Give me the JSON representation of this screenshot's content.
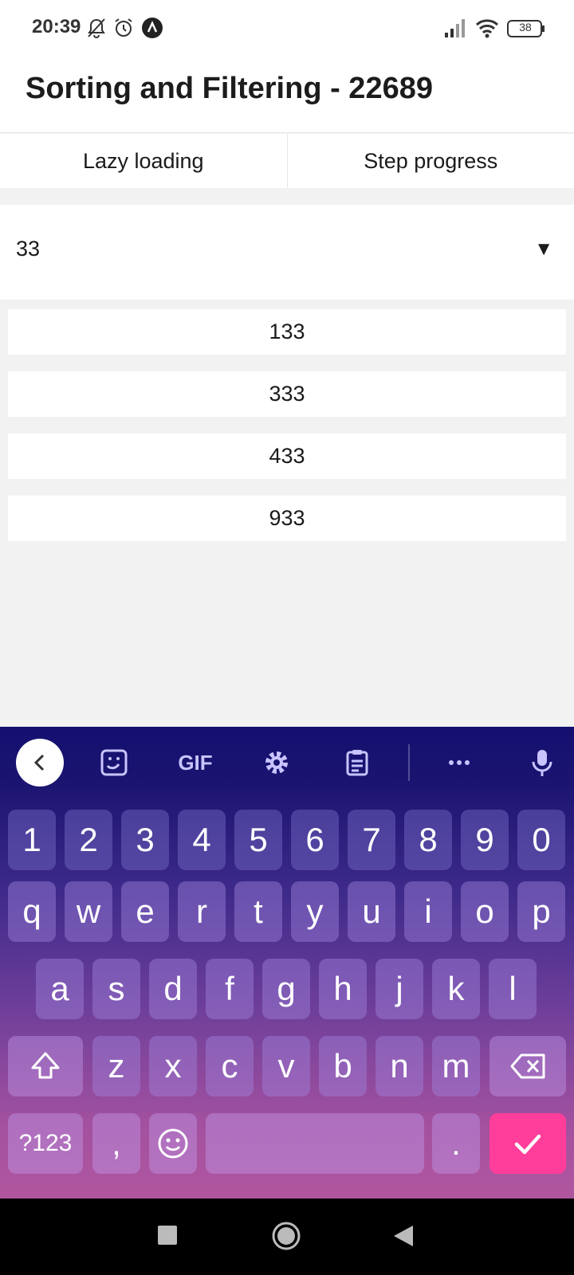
{
  "status_bar": {
    "time": "20:39",
    "battery": "38",
    "icons": [
      "bell-off-icon",
      "alarm-icon",
      "app-notification-icon",
      "signal-icon",
      "wifi-icon",
      "battery-icon"
    ]
  },
  "header": {
    "title": "Sorting and Filtering - 22689"
  },
  "tabs": [
    {
      "label": "Lazy loading"
    },
    {
      "label": "Step progress"
    }
  ],
  "select": {
    "value": "33",
    "arrow": "▼"
  },
  "results": [
    {
      "label": "133"
    },
    {
      "label": "333"
    },
    {
      "label": "433"
    },
    {
      "label": "933"
    }
  ],
  "keyboard": {
    "toolbar": [
      "back-icon",
      "sticker-icon",
      "GIF",
      "settings-icon",
      "clipboard-icon",
      "more-icon",
      "mic-icon"
    ],
    "gif_label": "GIF",
    "row_numbers": [
      "1",
      "2",
      "3",
      "4",
      "5",
      "6",
      "7",
      "8",
      "9",
      "0"
    ],
    "row1": [
      "q",
      "w",
      "e",
      "r",
      "t",
      "y",
      "u",
      "i",
      "o",
      "p"
    ],
    "row2": [
      "a",
      "s",
      "d",
      "f",
      "g",
      "h",
      "j",
      "k",
      "l"
    ],
    "row3": [
      "z",
      "x",
      "c",
      "v",
      "b",
      "n",
      "m"
    ],
    "bottom": {
      "symbols": "?123",
      "comma": ",",
      "period": "."
    }
  },
  "colors": {
    "keyboard_top": "#141070",
    "keyboard_bottom": "#b0569f",
    "enter_key": "#ff3d9a"
  }
}
